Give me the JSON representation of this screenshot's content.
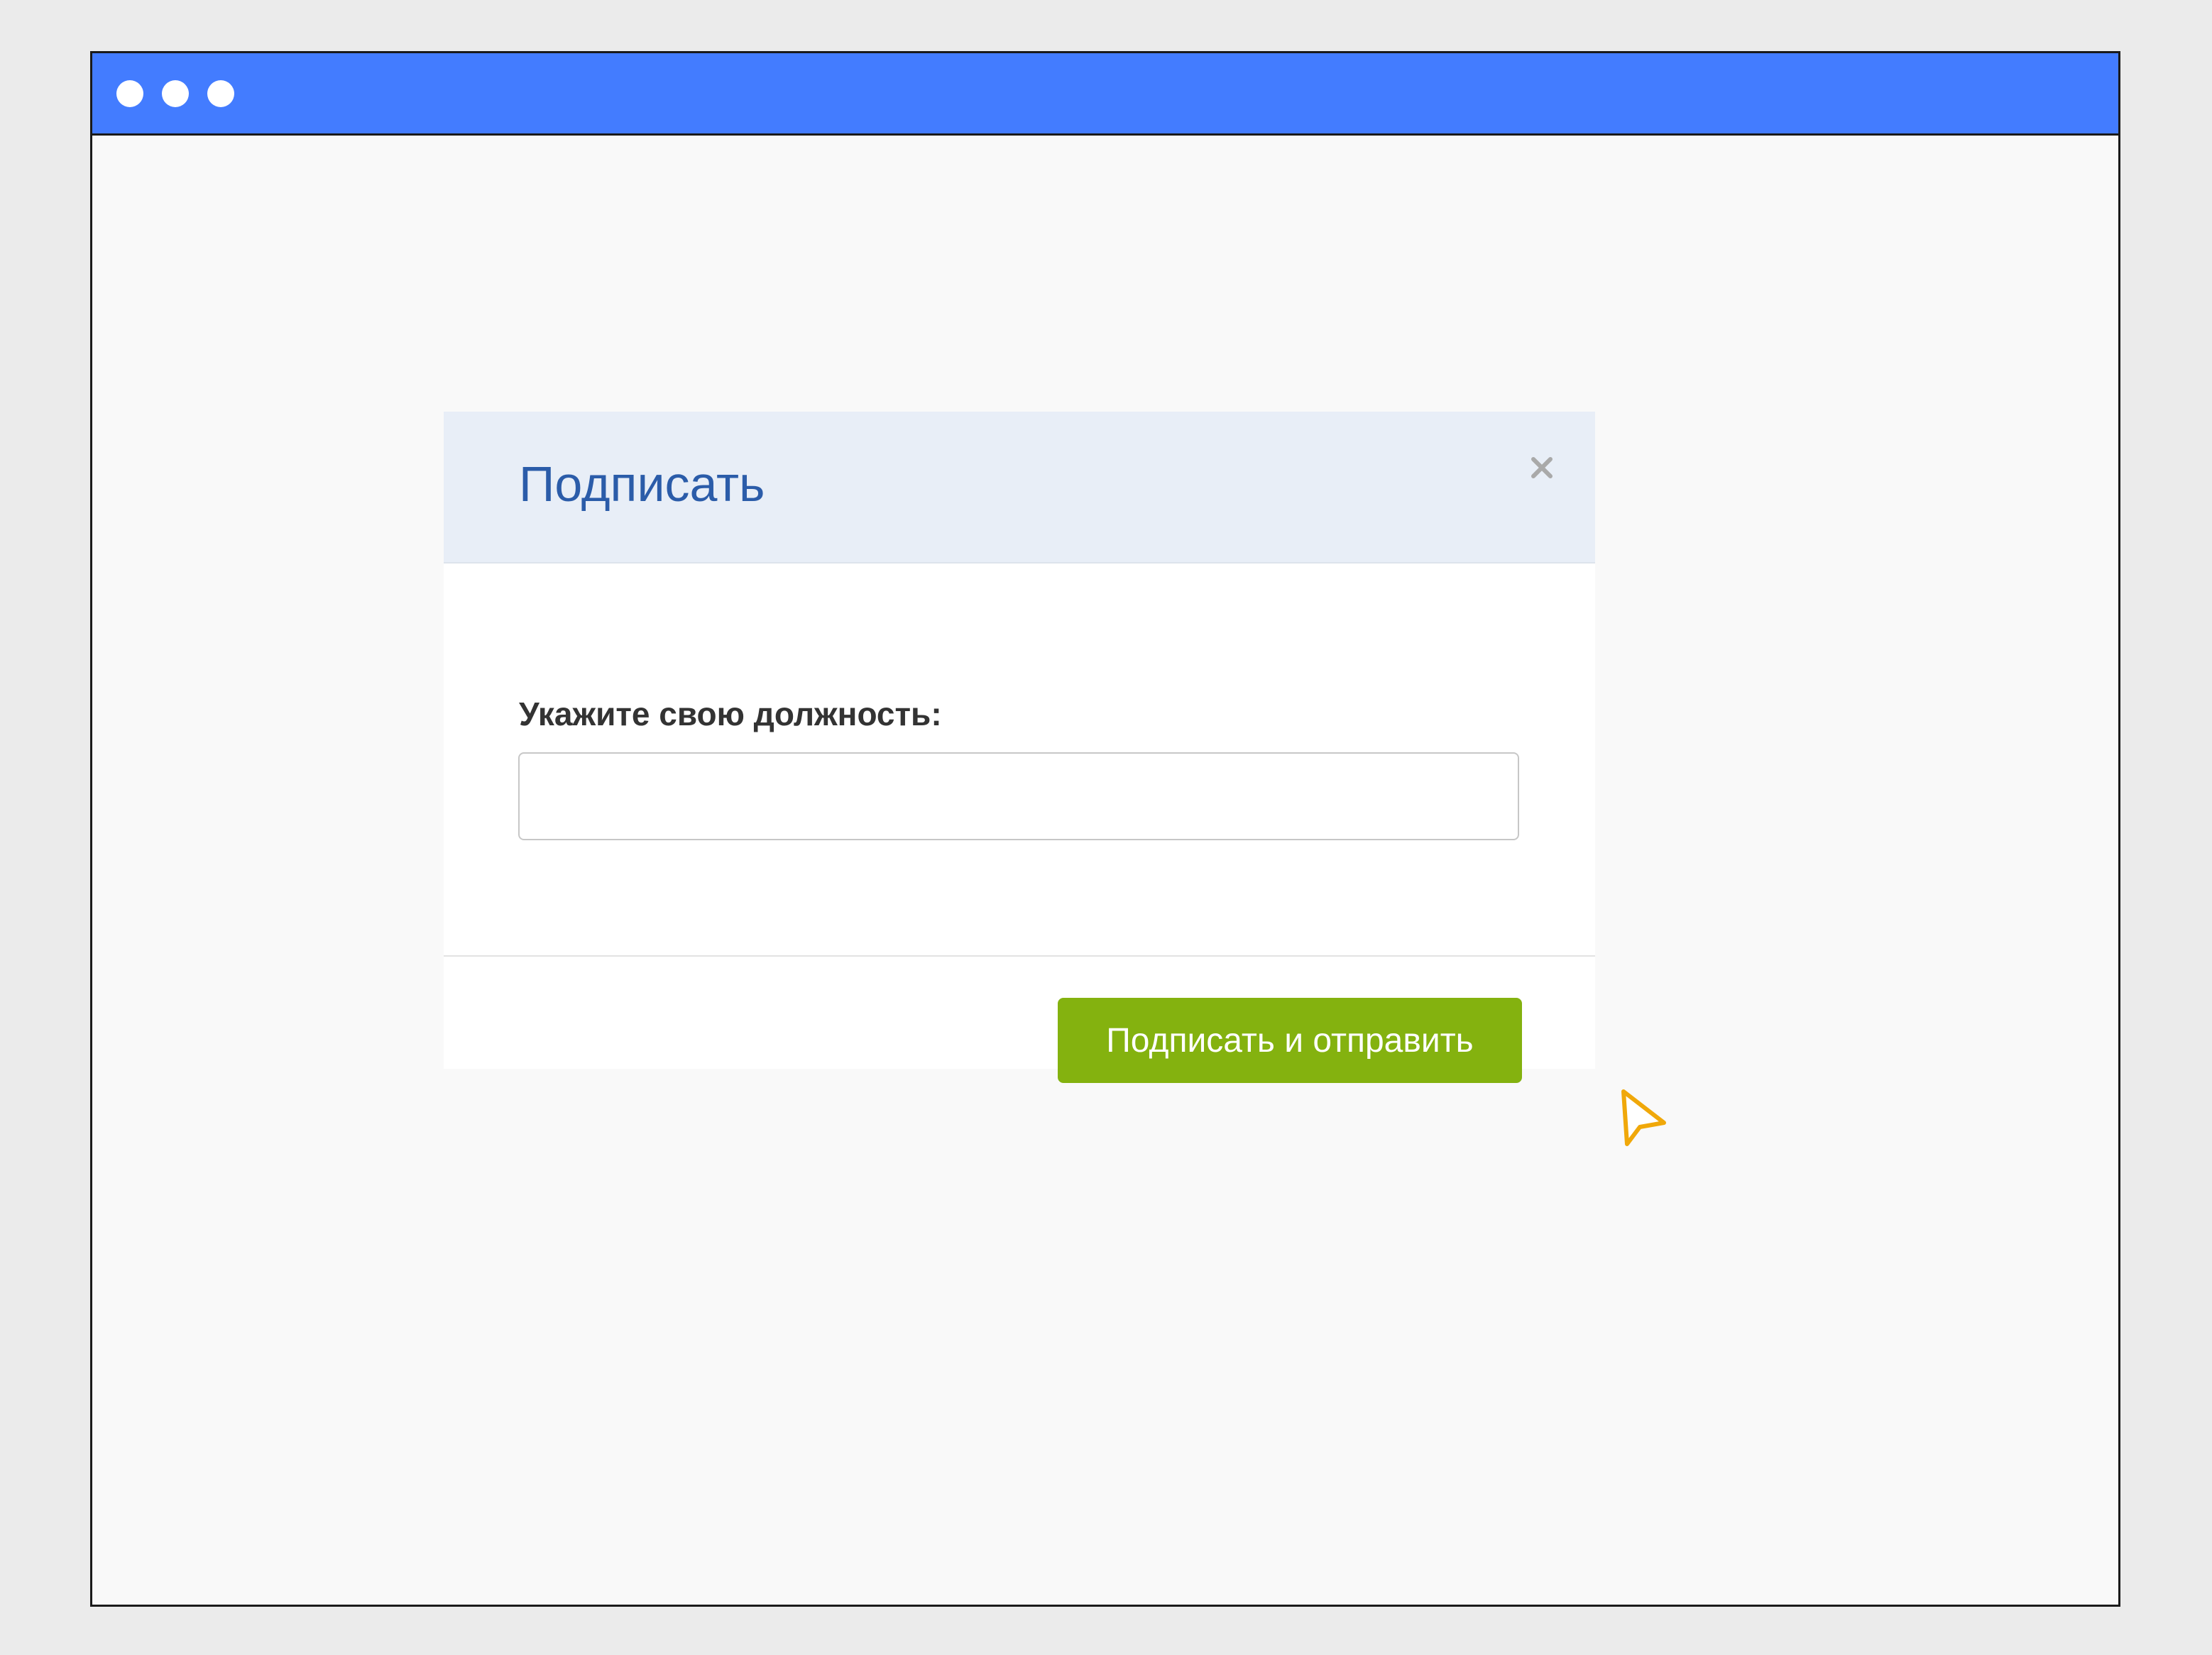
{
  "window": {
    "controls": [
      {
        "icon": "window-dot-icon"
      },
      {
        "icon": "window-dot-icon"
      },
      {
        "icon": "window-dot-icon"
      }
    ]
  },
  "dialog": {
    "title": "Подписать",
    "close_icon": "close-icon",
    "field_label": "Укажите свою должность:",
    "input_value": "",
    "input_placeholder": "",
    "submit_label": "Подписать и отправить"
  },
  "cursor": {
    "icon": "mouse-pointer-icon"
  },
  "colors": {
    "title_bar": "#437cff",
    "dialog_header": "#e8eef7",
    "dialog_title": "#2b5ca9",
    "submit_button": "#84b20f",
    "cursor": "#f0a80a"
  }
}
